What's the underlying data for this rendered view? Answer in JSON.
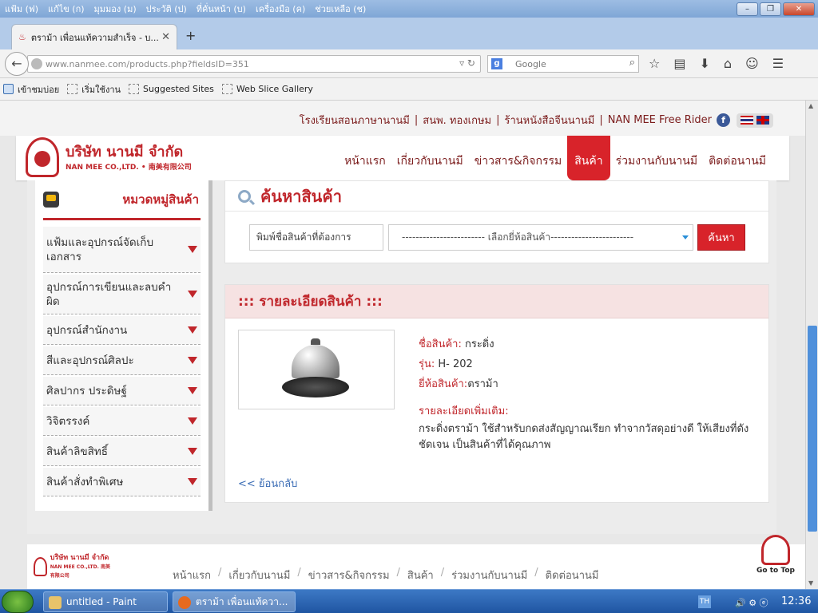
{
  "window": {
    "menu": [
      "แฟ้ม (ฟ)",
      "แก้ไข (ก)",
      "มุมมอง (ม)",
      "ประวัติ (ป)",
      "ที่คั่นหน้า (บ)",
      "เครื่องมือ (ค)",
      "ช่วยเหลือ (ช)"
    ]
  },
  "browser": {
    "tab_title": "ตราม้า เพื่อนแท้ความสำเร็จ - บ...",
    "url": "www.nanmee.com/products.php?fieldsID=351",
    "search_placeholder": "Google",
    "bookmarks": [
      "เข้าชมบ่อย",
      "เริ่มใช้งาน",
      "Suggested Sites",
      "Web Slice Gallery"
    ]
  },
  "site": {
    "top_links": [
      "โรงเรียนสอนภาษานานมี",
      "สนพ. ทองเกษม",
      "ร้านหนังสือจีนนานมี",
      "NAN MEE Free Rider"
    ],
    "logo_th": "บริษัท นานมี จำกัด",
    "logo_en": "NAN MEE CO.,LTD. • 南美有限公司",
    "nav": [
      "หน้าแรก",
      "เกี่ยวกับนานมี",
      "ข่าวสาร&กิจกรรม",
      "สินค้า",
      "ร่วมงานกับนานมี",
      "ติดต่อนานมี"
    ],
    "active_nav": "สินค้า"
  },
  "sidebar": {
    "title": "หมวดหมู่สินค้า",
    "categories": [
      "แฟ้มและอุปกรณ์จัดเก็บเอกสาร",
      "อุปกรณ์การเขียนและลบคำผิด",
      "อุปกรณ์สำนักงาน",
      "สีและอุปกรณ์ศิลปะ",
      "ศิลปากร ประดิษฐ์",
      "วิจิตรรงค์",
      "สินค้าลิขสิทธิ์",
      "สินค้าสั่งทำพิเศษ"
    ]
  },
  "search": {
    "title": "ค้นหาสินค้า",
    "input_value": "พิมพ์ชื่อสินค้าที่ต้องการ",
    "brand_select": "------------------------ เลือกยี่ห้อสินค้า------------------------",
    "button": "ค้นหา"
  },
  "product": {
    "section_title": "::: รายละเอียดสินค้า :::",
    "name_label": "ชื่อสินค้า:",
    "name": "กระดิ่ง",
    "model_label": "รุ่น:",
    "model": "H- 202",
    "brand_label": "ยี่ห้อสินค้า:",
    "brand": "ตราม้า",
    "more_label": "รายละเอียดเพิ่มเติม:",
    "description": "กระดิ่งตราม้า ใช้สำหรับกดส่งสัญญาณเรียก ทำจากวัสดุอย่างดี ให้เสียงที่ดัง ชัดเจน เป็นสินค้าที่ได้คุณภาพ",
    "back_link": "<< ย้อนกลับ"
  },
  "footer": {
    "logo_th": "บริษัท นานมี จำกัด",
    "logo_en": "NAN MEE CO.,LTD. 南美有限公司",
    "nav": [
      "หน้าแรก",
      "เกี่ยวกับนานมี",
      "ข่าวสาร&กิจกรรม",
      "สินค้า",
      "ร่วมงานกับนานมี",
      "ติดต่อนานมี"
    ],
    "go_top": "Go to Top"
  },
  "taskbar": {
    "task1": "untitled - Paint",
    "task2": "ตราม้า เพื่อนแท้ควา...",
    "lang": "TH",
    "clock": "12:36"
  }
}
